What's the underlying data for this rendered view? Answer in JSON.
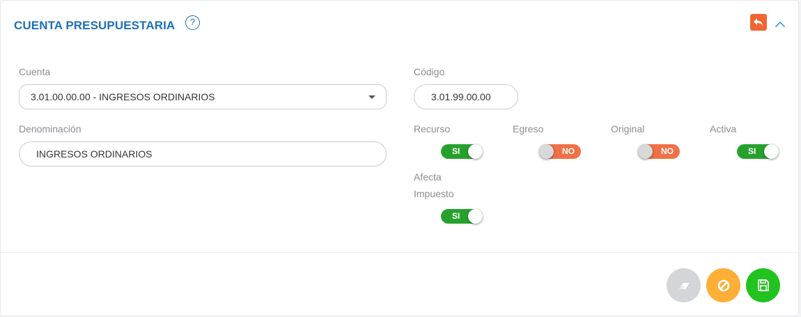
{
  "header": {
    "title": "CUENTA PRESUPUESTARIA",
    "help_icon": "question-circle-icon",
    "help_symbol": "?",
    "back_icon": "reply-icon",
    "collapse_icon": "chevron-up-icon"
  },
  "form": {
    "cuenta": {
      "label": "Cuenta",
      "value": "3.01.00.00.00 - INGRESOS ORDINARIOS"
    },
    "codigo": {
      "label": "Código",
      "value": "3.01.99.00.00"
    },
    "denominacion": {
      "label": "Denominación",
      "value": "INGRESOS ORDINARIOS"
    },
    "toggles": {
      "recurso": {
        "label": "Recurso",
        "state": "SI"
      },
      "egreso": {
        "label": "Egreso",
        "state": "NO"
      },
      "original": {
        "label": "Original",
        "state": "NO"
      },
      "activa": {
        "label": "Activa",
        "state": "SI"
      },
      "afecta_impuesto": {
        "label_line1": "Afecta",
        "label_line2": "Impuesto",
        "state": "SI"
      }
    }
  },
  "actions": {
    "clear": {
      "icon": "eraser-icon",
      "color": "#d3d5d8"
    },
    "cancel": {
      "icon": "ban-icon",
      "color": "#ffae36"
    },
    "save": {
      "icon": "floppy-disk-icon",
      "color": "#22c21f"
    }
  },
  "colors": {
    "accent": "#1d6fb8",
    "toggle_on": "#27a12e",
    "toggle_off": "#f07047",
    "back_button": "#f26532"
  }
}
